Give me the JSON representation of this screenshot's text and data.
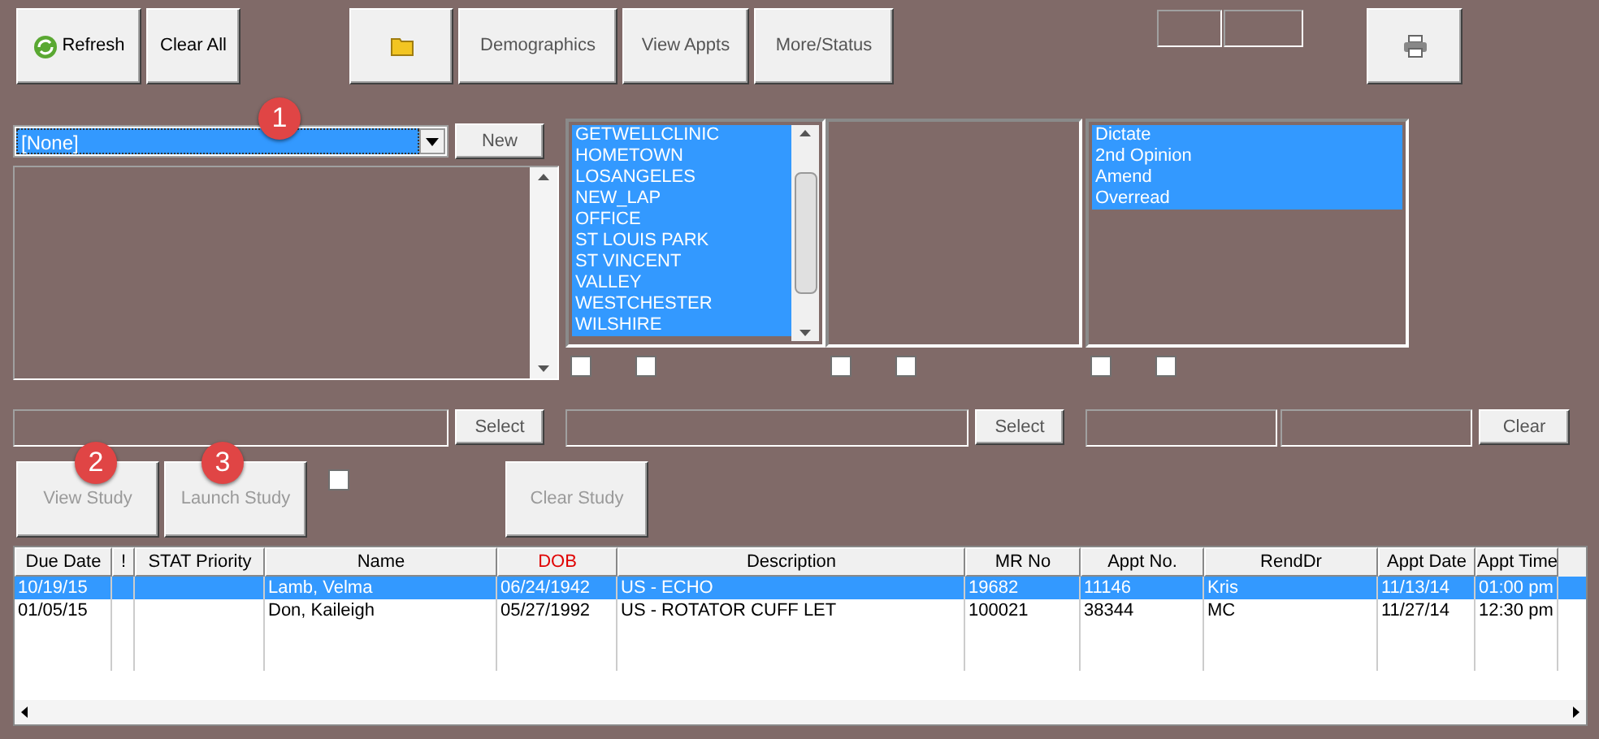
{
  "toolbar": {
    "buttons": [
      {
        "label": "Refresh",
        "kind": "refresh",
        "disabled": false
      },
      {
        "label": "Clear All",
        "kind": "text",
        "disabled": false
      },
      {
        "kind": "folder"
      },
      {
        "label": "Demographics",
        "kind": "text",
        "disabled": true
      },
      {
        "label": "View Appts",
        "kind": "text",
        "disabled": true
      },
      {
        "label": "More/Status",
        "kind": "text",
        "disabled": true
      }
    ]
  },
  "callouts": [
    "1",
    "2",
    "3"
  ],
  "combo": {
    "value": "[None]",
    "button": "New"
  },
  "lists": [
    {
      "items": [
        {
          "label": "GETWELLCLINIC",
          "selected": true
        },
        {
          "label": "HOMETOWN",
          "selected": true
        },
        {
          "label": "LOSANGELES",
          "selected": true
        },
        {
          "label": "NEW_LAP",
          "selected": true
        },
        {
          "label": "OFFICE",
          "selected": true
        },
        {
          "label": "ST LOUIS PARK",
          "selected": true
        },
        {
          "label": "ST VINCENT",
          "selected": true
        },
        {
          "label": "VALLEY",
          "selected": true
        },
        {
          "label": "WESTCHESTER",
          "selected": true
        },
        {
          "label": "WILSHIRE",
          "selected": true
        }
      ],
      "checkboxes": [
        {
          "checked": false
        },
        {
          "checked": false
        }
      ]
    },
    {
      "checkboxes": [
        {
          "checked": false
        },
        {
          "checked": false
        }
      ]
    },
    {
      "items": [
        {
          "label": "Dictate",
          "selected": true
        },
        {
          "label": "2nd Opinion",
          "selected": true
        },
        {
          "label": "Amend",
          "selected": true
        },
        {
          "label": "Overread",
          "selected": true
        }
      ],
      "checkboxes": [
        {
          "checked": false
        },
        {
          "checked": false
        }
      ]
    }
  ],
  "pickers": {
    "select_1": "Select",
    "select_2": "Select",
    "clear": "Clear"
  },
  "study_buttons": [
    {
      "label": "View Study",
      "disabled": true
    },
    {
      "label": "Launch Study",
      "disabled": true
    },
    {
      "label": "Clear Study",
      "disabled": true
    }
  ],
  "study_checkbox": {
    "checked": false
  },
  "table": {
    "columns": [
      {
        "label": "Due Date",
        "highlight": false
      },
      {
        "label": "!",
        "highlight": false
      },
      {
        "label": "STAT Priority",
        "highlight": false
      },
      {
        "label": "Name",
        "highlight": false
      },
      {
        "label": "DOB",
        "highlight": true
      },
      {
        "label": "Description",
        "highlight": false
      },
      {
        "label": "MR No",
        "highlight": false
      },
      {
        "label": "Appt No.",
        "highlight": false
      },
      {
        "label": "RendDr",
        "highlight": false
      },
      {
        "label": "Appt Date",
        "highlight": false
      },
      {
        "label": "Appt Time",
        "highlight": false
      }
    ],
    "rows": [
      {
        "selected": true,
        "cells": [
          "10/19/15",
          "",
          "",
          "Lamb, Velma",
          "06/24/1942",
          "US - ECHO",
          "19682",
          "11146",
          "Kris",
          "11/13/14",
          "01:00 pm"
        ]
      },
      {
        "selected": false,
        "cells": [
          "01/05/15",
          "",
          "",
          "Don, Kaileigh",
          "05/27/1992",
          "US - ROTATOR CUFF LET",
          "100021",
          "38344",
          "MC",
          "11/27/14",
          "12:30 pm"
        ]
      }
    ]
  }
}
